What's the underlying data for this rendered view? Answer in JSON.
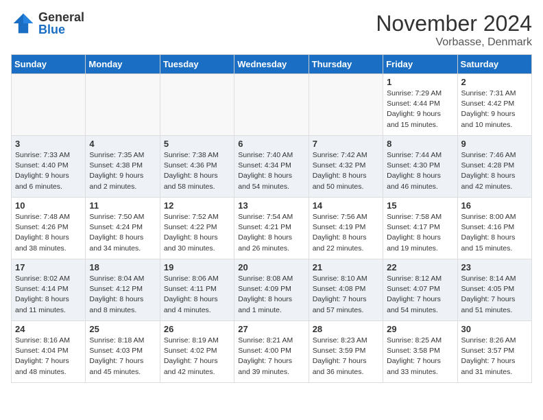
{
  "header": {
    "logo_general": "General",
    "logo_blue": "Blue",
    "title": "November 2024",
    "location": "Vorbasse, Denmark"
  },
  "weekdays": [
    "Sunday",
    "Monday",
    "Tuesday",
    "Wednesday",
    "Thursday",
    "Friday",
    "Saturday"
  ],
  "weeks": [
    [
      {
        "num": "",
        "info": ""
      },
      {
        "num": "",
        "info": ""
      },
      {
        "num": "",
        "info": ""
      },
      {
        "num": "",
        "info": ""
      },
      {
        "num": "",
        "info": ""
      },
      {
        "num": "1",
        "info": "Sunrise: 7:29 AM\nSunset: 4:44 PM\nDaylight: 9 hours and 15 minutes."
      },
      {
        "num": "2",
        "info": "Sunrise: 7:31 AM\nSunset: 4:42 PM\nDaylight: 9 hours and 10 minutes."
      }
    ],
    [
      {
        "num": "3",
        "info": "Sunrise: 7:33 AM\nSunset: 4:40 PM\nDaylight: 9 hours and 6 minutes."
      },
      {
        "num": "4",
        "info": "Sunrise: 7:35 AM\nSunset: 4:38 PM\nDaylight: 9 hours and 2 minutes."
      },
      {
        "num": "5",
        "info": "Sunrise: 7:38 AM\nSunset: 4:36 PM\nDaylight: 8 hours and 58 minutes."
      },
      {
        "num": "6",
        "info": "Sunrise: 7:40 AM\nSunset: 4:34 PM\nDaylight: 8 hours and 54 minutes."
      },
      {
        "num": "7",
        "info": "Sunrise: 7:42 AM\nSunset: 4:32 PM\nDaylight: 8 hours and 50 minutes."
      },
      {
        "num": "8",
        "info": "Sunrise: 7:44 AM\nSunset: 4:30 PM\nDaylight: 8 hours and 46 minutes."
      },
      {
        "num": "9",
        "info": "Sunrise: 7:46 AM\nSunset: 4:28 PM\nDaylight: 8 hours and 42 minutes."
      }
    ],
    [
      {
        "num": "10",
        "info": "Sunrise: 7:48 AM\nSunset: 4:26 PM\nDaylight: 8 hours and 38 minutes."
      },
      {
        "num": "11",
        "info": "Sunrise: 7:50 AM\nSunset: 4:24 PM\nDaylight: 8 hours and 34 minutes."
      },
      {
        "num": "12",
        "info": "Sunrise: 7:52 AM\nSunset: 4:22 PM\nDaylight: 8 hours and 30 minutes."
      },
      {
        "num": "13",
        "info": "Sunrise: 7:54 AM\nSunset: 4:21 PM\nDaylight: 8 hours and 26 minutes."
      },
      {
        "num": "14",
        "info": "Sunrise: 7:56 AM\nSunset: 4:19 PM\nDaylight: 8 hours and 22 minutes."
      },
      {
        "num": "15",
        "info": "Sunrise: 7:58 AM\nSunset: 4:17 PM\nDaylight: 8 hours and 19 minutes."
      },
      {
        "num": "16",
        "info": "Sunrise: 8:00 AM\nSunset: 4:16 PM\nDaylight: 8 hours and 15 minutes."
      }
    ],
    [
      {
        "num": "17",
        "info": "Sunrise: 8:02 AM\nSunset: 4:14 PM\nDaylight: 8 hours and 11 minutes."
      },
      {
        "num": "18",
        "info": "Sunrise: 8:04 AM\nSunset: 4:12 PM\nDaylight: 8 hours and 8 minutes."
      },
      {
        "num": "19",
        "info": "Sunrise: 8:06 AM\nSunset: 4:11 PM\nDaylight: 8 hours and 4 minutes."
      },
      {
        "num": "20",
        "info": "Sunrise: 8:08 AM\nSunset: 4:09 PM\nDaylight: 8 hours and 1 minute."
      },
      {
        "num": "21",
        "info": "Sunrise: 8:10 AM\nSunset: 4:08 PM\nDaylight: 7 hours and 57 minutes."
      },
      {
        "num": "22",
        "info": "Sunrise: 8:12 AM\nSunset: 4:07 PM\nDaylight: 7 hours and 54 minutes."
      },
      {
        "num": "23",
        "info": "Sunrise: 8:14 AM\nSunset: 4:05 PM\nDaylight: 7 hours and 51 minutes."
      }
    ],
    [
      {
        "num": "24",
        "info": "Sunrise: 8:16 AM\nSunset: 4:04 PM\nDaylight: 7 hours and 48 minutes."
      },
      {
        "num": "25",
        "info": "Sunrise: 8:18 AM\nSunset: 4:03 PM\nDaylight: 7 hours and 45 minutes."
      },
      {
        "num": "26",
        "info": "Sunrise: 8:19 AM\nSunset: 4:02 PM\nDaylight: 7 hours and 42 minutes."
      },
      {
        "num": "27",
        "info": "Sunrise: 8:21 AM\nSunset: 4:00 PM\nDaylight: 7 hours and 39 minutes."
      },
      {
        "num": "28",
        "info": "Sunrise: 8:23 AM\nSunset: 3:59 PM\nDaylight: 7 hours and 36 minutes."
      },
      {
        "num": "29",
        "info": "Sunrise: 8:25 AM\nSunset: 3:58 PM\nDaylight: 7 hours and 33 minutes."
      },
      {
        "num": "30",
        "info": "Sunrise: 8:26 AM\nSunset: 3:57 PM\nDaylight: 7 hours and 31 minutes."
      }
    ]
  ]
}
